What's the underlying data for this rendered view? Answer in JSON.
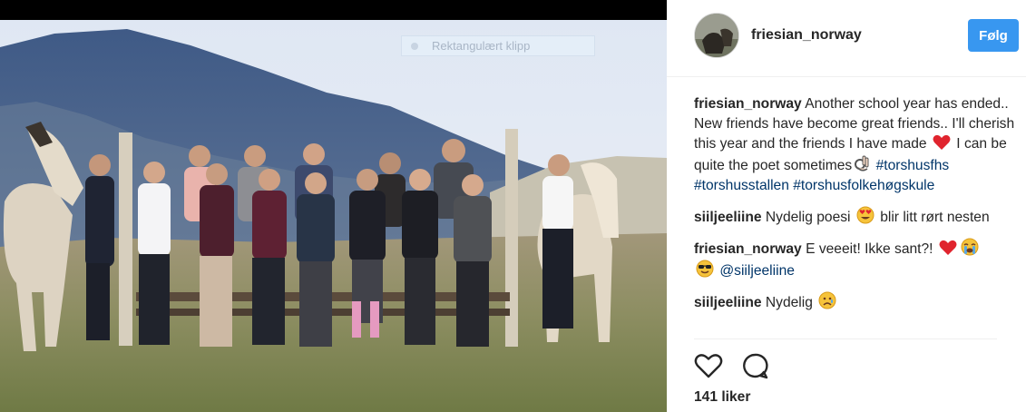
{
  "snip_toolbar": {
    "label": "Rektangulært klipp"
  },
  "post": {
    "username": "friesian_norway",
    "follow_label": "Følg",
    "likes": "141 liker"
  },
  "comments": [
    {
      "user": "friesian_norway",
      "text_1": "Another school year has ended.. New friends have become great friends.. I'll cherish this year and the friends I have made",
      "text_2": "I can be quite the poet sometimes",
      "hashtags": [
        "#torshusfhs",
        "#torshusstallen",
        "#torshusfolkehøgskule"
      ],
      "emojis": [
        "red-heart",
        "ok-hand"
      ]
    },
    {
      "user": "siiljeeliine",
      "text_1": "Nydelig poesi",
      "text_2": "blir litt rørt nesten",
      "emojis": [
        "heart-eyes"
      ]
    },
    {
      "user": "friesian_norway",
      "text_1": "E veeeit! Ikke sant?!",
      "mention": "@siiljeeliine",
      "emojis": [
        "red-heart",
        "crying",
        "sunglasses"
      ]
    },
    {
      "user": "siiljeeliine",
      "text_1": "Nydelig",
      "emojis": [
        "sad-face"
      ]
    }
  ],
  "colors": {
    "follow_button": "#3897f0",
    "hashtag": "#003569",
    "text": "#262626",
    "divider": "#efefef"
  }
}
